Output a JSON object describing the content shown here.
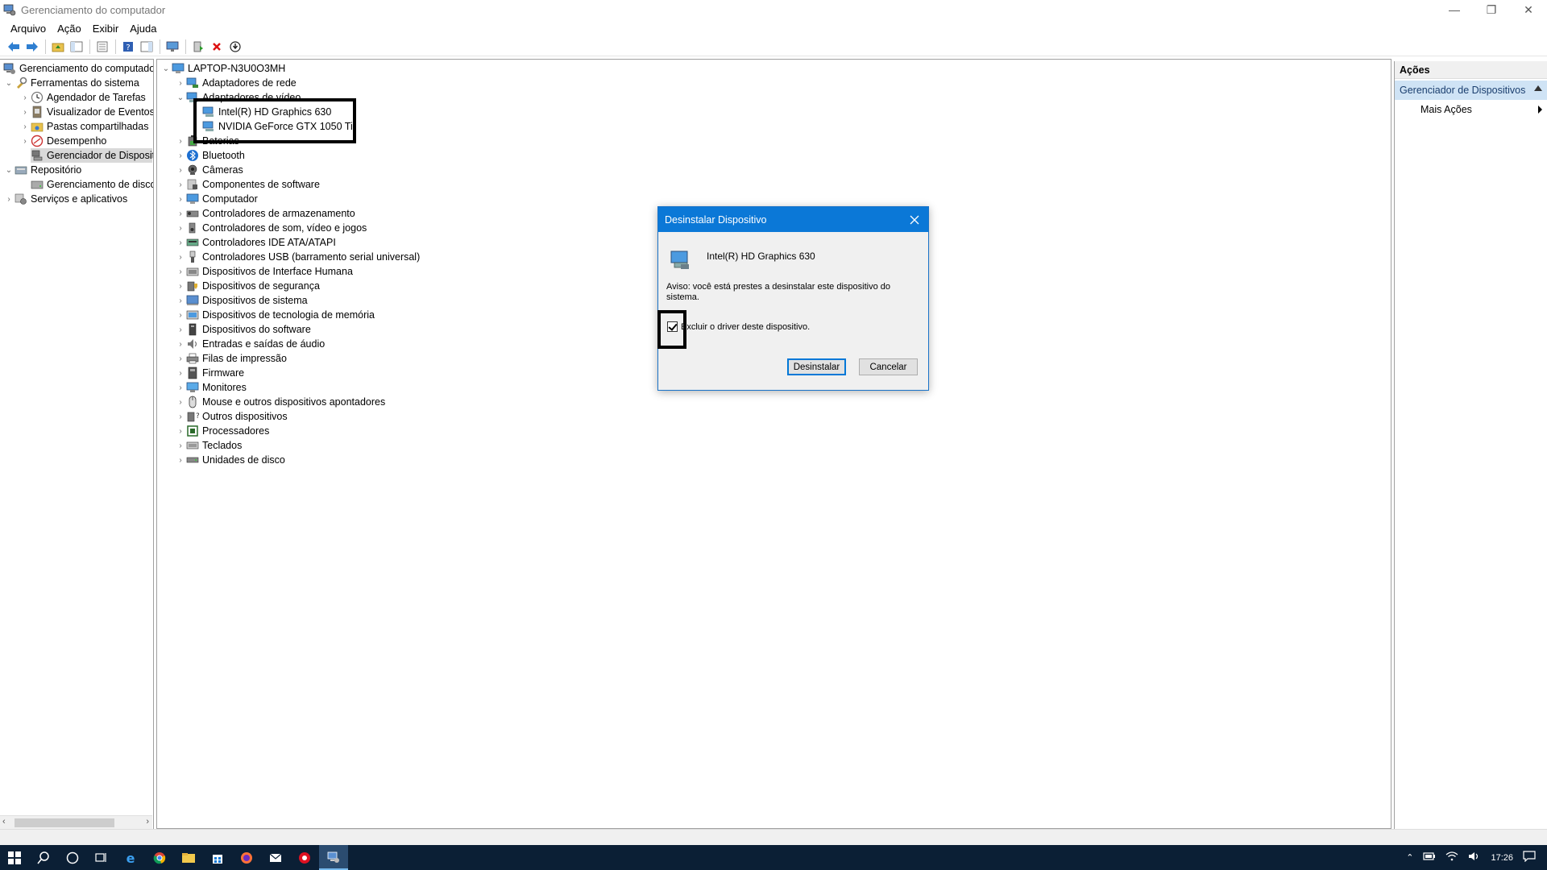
{
  "window": {
    "title": "Gerenciamento do computador",
    "controls": [
      "—",
      "❐",
      "✕"
    ]
  },
  "menu": [
    "Arquivo",
    "Ação",
    "Exibir",
    "Ajuda"
  ],
  "left_tree": [
    {
      "label": "Gerenciamento do computado",
      "level": 0,
      "expander": "",
      "icon": "computer-management-icon"
    },
    {
      "label": "Ferramentas do sistema",
      "level": 1,
      "expander": "v",
      "icon": "tools-icon"
    },
    {
      "label": "Agendador de Tarefas",
      "level": 2,
      "expander": ">",
      "icon": "clock-icon"
    },
    {
      "label": "Visualizador de Eventos",
      "level": 2,
      "expander": ">",
      "icon": "event-viewer-icon"
    },
    {
      "label": "Pastas compartilhadas",
      "level": 2,
      "expander": ">",
      "icon": "shared-folder-icon"
    },
    {
      "label": "Desempenho",
      "level": 2,
      "expander": ">",
      "icon": "performance-icon"
    },
    {
      "label": "Gerenciador de Disposit",
      "level": 2,
      "expander": "",
      "icon": "device-manager-icon",
      "selected": true
    },
    {
      "label": "Repositório",
      "level": 1,
      "expander": "v",
      "icon": "storage-icon"
    },
    {
      "label": "Gerenciamento de disco",
      "level": 2,
      "expander": "",
      "icon": "disk-icon"
    },
    {
      "label": "Serviços e aplicativos",
      "level": 1,
      "expander": ">",
      "icon": "services-icon"
    }
  ],
  "device_tree": {
    "root": "LAPTOP-N3U0O3MH",
    "items": [
      {
        "label": "Adaptadores de rede",
        "expander": ">",
        "icon": "network-icon"
      },
      {
        "label": "Adaptadores de vídeo",
        "expander": "v",
        "icon": "display-adapter-icon"
      },
      {
        "label": "Intel(R) HD Graphics 630",
        "expander": "",
        "icon": "display-adapter-icon",
        "child": true
      },
      {
        "label": "NVIDIA GeForce GTX 1050 Ti",
        "expander": "",
        "icon": "display-adapter-icon",
        "child": true
      },
      {
        "label": "Baterias",
        "expander": ">",
        "icon": "battery-icon"
      },
      {
        "label": "Bluetooth",
        "expander": ">",
        "icon": "bluetooth-icon"
      },
      {
        "label": "Câmeras",
        "expander": ">",
        "icon": "camera-icon"
      },
      {
        "label": "Componentes de software",
        "expander": ">",
        "icon": "software-component-icon"
      },
      {
        "label": "Computador",
        "expander": ">",
        "icon": "computer-icon"
      },
      {
        "label": "Controladores de armazenamento",
        "expander": ">",
        "icon": "storage-controller-icon"
      },
      {
        "label": "Controladores de som, vídeo e jogos",
        "expander": ">",
        "icon": "sound-icon"
      },
      {
        "label": "Controladores IDE ATA/ATAPI",
        "expander": ">",
        "icon": "ide-icon"
      },
      {
        "label": "Controladores USB (barramento serial universal)",
        "expander": ">",
        "icon": "usb-icon"
      },
      {
        "label": "Dispositivos de Interface Humana",
        "expander": ">",
        "icon": "hid-icon"
      },
      {
        "label": "Dispositivos de segurança",
        "expander": ">",
        "icon": "security-icon"
      },
      {
        "label": "Dispositivos de sistema",
        "expander": ">",
        "icon": "system-device-icon"
      },
      {
        "label": "Dispositivos de tecnologia de memória",
        "expander": ">",
        "icon": "memory-icon"
      },
      {
        "label": "Dispositivos do software",
        "expander": ">",
        "icon": "software-device-icon"
      },
      {
        "label": "Entradas e saídas de áudio",
        "expander": ">",
        "icon": "audio-icon"
      },
      {
        "label": "Filas de impressão",
        "expander": ">",
        "icon": "printer-icon"
      },
      {
        "label": "Firmware",
        "expander": ">",
        "icon": "firmware-icon"
      },
      {
        "label": "Monitores",
        "expander": ">",
        "icon": "monitor-icon"
      },
      {
        "label": "Mouse e outros dispositivos apontadores",
        "expander": ">",
        "icon": "mouse-icon"
      },
      {
        "label": "Outros dispositivos",
        "expander": ">",
        "icon": "other-devices-icon"
      },
      {
        "label": "Processadores",
        "expander": ">",
        "icon": "processor-icon"
      },
      {
        "label": "Teclados",
        "expander": ">",
        "icon": "keyboard-icon"
      },
      {
        "label": "Unidades de disco",
        "expander": ">",
        "icon": "disk-drive-icon"
      }
    ]
  },
  "actions": {
    "header": "Ações",
    "section": "Gerenciador de Dispositivos",
    "more": "Mais Ações"
  },
  "dialog": {
    "title": "Desinstalar Dispositivo",
    "device": "Intel(R) HD Graphics 630",
    "warning": "Aviso: você está prestes a desinstalar este dispositivo do sistema.",
    "checkbox_label": "Excluir o driver deste dispositivo.",
    "checkbox_checked": true,
    "uninstall": "Desinstalar",
    "cancel": "Cancelar"
  },
  "taskbar": {
    "time": "17:26"
  },
  "colors": {
    "dialog_title_bg": "#0b78d7",
    "taskbar_bg": "#0b1f35",
    "actions_section_bg": "#cfe3f5"
  }
}
